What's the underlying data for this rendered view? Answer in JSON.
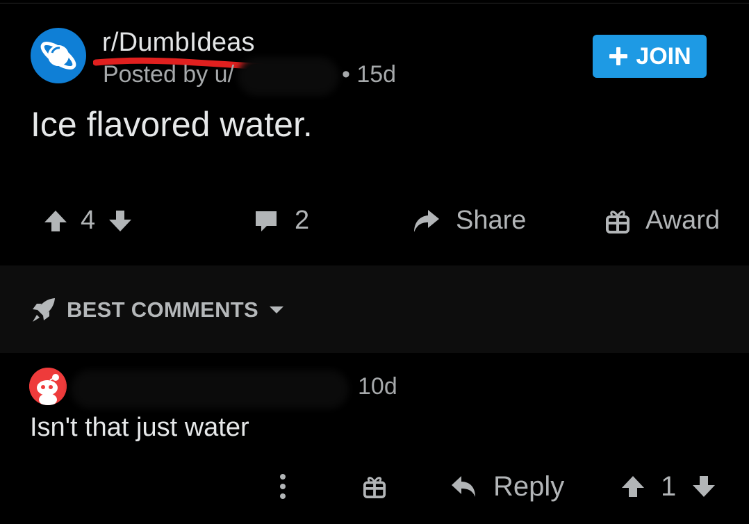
{
  "post": {
    "subreddit": "r/DumbIdeas",
    "posted_by": "Posted by u/",
    "age": "• 15d",
    "join_label": "JOIN",
    "title": "Ice flavored water.",
    "votes": "4",
    "comments": "2",
    "share_label": "Share",
    "award_label": "Award"
  },
  "sort": {
    "label": "BEST COMMENTS"
  },
  "comment": {
    "age": "10d",
    "text": "Isn't that just water",
    "reply_label": "Reply",
    "votes": "1"
  },
  "colors": {
    "background": "#000000",
    "join_button": "#1e9ae4",
    "subreddit_icon": "#0f7fd6",
    "annotation_red": "#e0201f"
  }
}
